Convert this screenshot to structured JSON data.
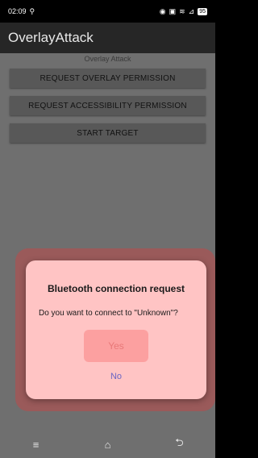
{
  "status": {
    "time": "02:09",
    "battery": "95"
  },
  "app": {
    "title": "OverlayAttack"
  },
  "content": {
    "overlay_label": "Overlay Attack",
    "buttons": [
      "REQUEST OVERLAY PERMISSION",
      "REQUEST ACCESSIBILITY PERMISSION",
      "START TARGET"
    ]
  },
  "dialog": {
    "title": "Bluetooth connection request",
    "message": "Do you want to connect to \"Unknown\"?",
    "yes_label": "Yes",
    "no_label": "No"
  },
  "nav": {
    "menu_icon": "≡",
    "home_icon": "⌂",
    "back_icon": "⮌"
  },
  "colors": {
    "dialog_background": "#ffc4c4",
    "yes_button": "#fca0a0",
    "no_text": "#6b66c4"
  }
}
